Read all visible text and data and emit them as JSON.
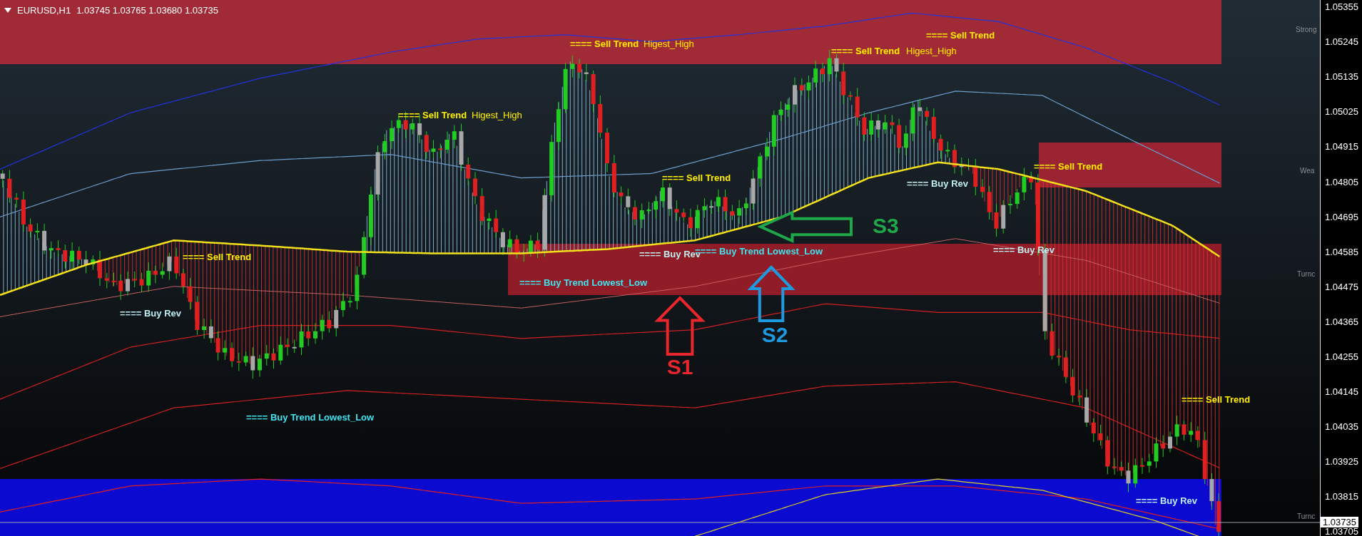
{
  "header": {
    "symbol": "EURUSD,H1",
    "quotes": "1.03745 1.03765 1.03680 1.03735"
  },
  "signals": [
    {
      "kind": "sell",
      "text": "==== Sell Trend"
    },
    {
      "kind": "sell",
      "text": "==== Sell Trend"
    },
    {
      "kind": "level",
      "text": "Higest_High"
    },
    {
      "kind": "sell",
      "text": "==== Sell Trend"
    },
    {
      "kind": "level",
      "text": "Higest_High"
    },
    {
      "kind": "sell",
      "text": "==== Sell Trend"
    },
    {
      "kind": "level",
      "text": "Higest_High"
    },
    {
      "kind": "sell",
      "text": "==== Sell Trend"
    },
    {
      "kind": "sell",
      "text": "==== Sell Trend"
    },
    {
      "kind": "rev",
      "text": "==== Buy Rev"
    },
    {
      "kind": "rev",
      "text": "==== Buy Rev"
    },
    {
      "kind": "buytrend",
      "text": "==== Buy Trend Lowest_Low"
    },
    {
      "kind": "rev",
      "text": "==== Buy Rev"
    },
    {
      "kind": "sell",
      "text": "==== Sell Trend"
    },
    {
      "kind": "buytrend",
      "text": "==== Buy Trend Lowest_Low"
    },
    {
      "kind": "rev",
      "text": "==== Buy Rev"
    },
    {
      "kind": "sell",
      "text": "==== Sell Trend"
    },
    {
      "kind": "buytrend",
      "text": "==== Buy Trend Lowest_Low"
    },
    {
      "kind": "rev",
      "text": "==== Buy Rev"
    }
  ],
  "markers": [
    {
      "label": "S3",
      "kind": "left",
      "color": "#1fa84a"
    },
    {
      "label": "S2",
      "kind": "up",
      "color": "#1e9be0"
    },
    {
      "label": "S1",
      "kind": "up",
      "color": "#e8262b"
    }
  ],
  "zone_labels": [
    "Strong",
    "Wea",
    "Turnc",
    "Turnc"
  ],
  "price_axis": {
    "labels": [
      "1.05355",
      "1.05245",
      "1.05135",
      "1.05025",
      "1.04915",
      "1.04805",
      "1.04695",
      "1.04585",
      "1.04475",
      "1.04365",
      "1.04255",
      "1.04145",
      "1.04035",
      "1.03925",
      "1.03815",
      "1.03705"
    ],
    "current_price": "1.03735"
  }
}
